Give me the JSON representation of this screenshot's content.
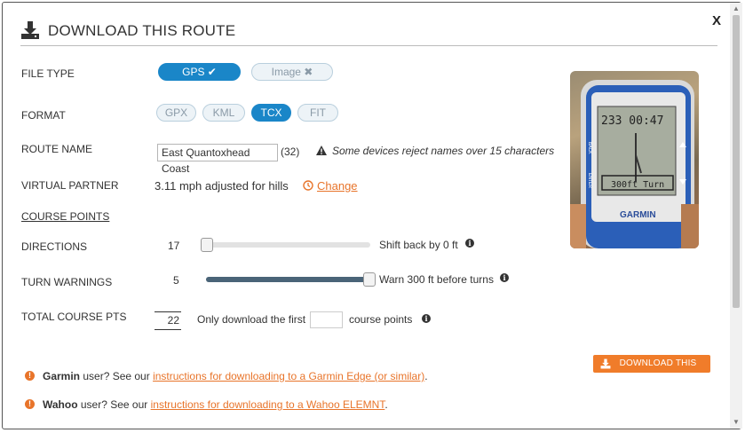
{
  "dialog": {
    "title": "DOWNLOAD THIS ROUTE",
    "close_label": "X"
  },
  "file_type": {
    "label": "FILE TYPE",
    "options": [
      {
        "label": "GPS ✔",
        "selected": true
      },
      {
        "label": "Image ✖",
        "selected": false
      }
    ]
  },
  "format": {
    "label": "FORMAT",
    "options": [
      {
        "label": "GPX",
        "selected": false
      },
      {
        "label": "KML",
        "selected": false
      },
      {
        "label": "TCX",
        "selected": true
      },
      {
        "label": "FIT",
        "selected": false
      }
    ]
  },
  "route_name": {
    "label": "ROUTE NAME",
    "value": "East Quantoxhead Coast",
    "char_count": "(32)",
    "warning": "Some devices reject names over 15 characters"
  },
  "virtual_partner": {
    "label": "VIRTUAL PARTNER",
    "value": "3.11 mph adjusted for hills",
    "change_link": "Change"
  },
  "course_points": {
    "label": "COURSE POINTS"
  },
  "directions": {
    "label": "DIRECTIONS",
    "value": "17",
    "slider_fraction": 0.0,
    "note": "Shift back by 0 ft"
  },
  "turn_warnings": {
    "label": "TURN WARNINGS",
    "value": "5",
    "slider_fraction": 1.0,
    "note": "Warn 300 ft before turns"
  },
  "total_course_pts": {
    "label": "TOTAL COURSE PTS",
    "value": "22",
    "prefix": "Only download the first",
    "input_value": "",
    "suffix": "course points"
  },
  "download_button": {
    "label": "DOWNLOAD THIS ROUTE"
  },
  "help": {
    "garmin_brand": "Garmin",
    "garmin_text": " user? See our ",
    "garmin_link": "instructions for downloading to a Garmin Edge (or similar)",
    "garmin_end": ".",
    "wahoo_brand": "Wahoo",
    "wahoo_text": " user? See our ",
    "wahoo_link": "instructions for downloading to a Wahoo ELEMNT",
    "wahoo_end": "."
  },
  "device_photo": {
    "screen_text_top": "233 00:47",
    "screen_text_bottom": "300ft Turn",
    "brand": "GARMIN",
    "side_left": "BACK",
    "side_left2": "ENTER"
  },
  "colors": {
    "accent_blue": "#1a86c8",
    "accent_orange": "#f07c2a",
    "slider_fill": "#4a6478"
  },
  "icons": {
    "header": "download-tray-icon",
    "warning": "warning-triangle-icon",
    "clock": "clock-icon",
    "info": "info-circle-icon",
    "alert": "exclamation-circle-icon"
  }
}
